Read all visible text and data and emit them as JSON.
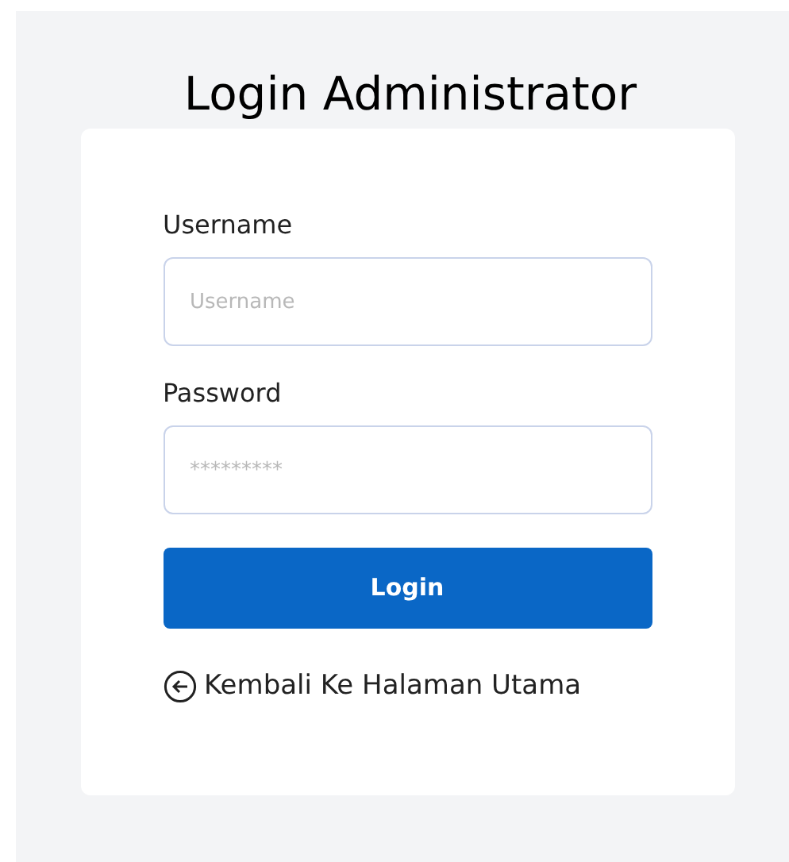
{
  "title": "Login Administrator",
  "fields": [
    {
      "label": "Username",
      "placeholder": "Username"
    },
    {
      "label": "Password",
      "placeholder": "*********"
    }
  ],
  "submit_button": "Login",
  "back_link": "Kembali Ke Halaman Utama"
}
